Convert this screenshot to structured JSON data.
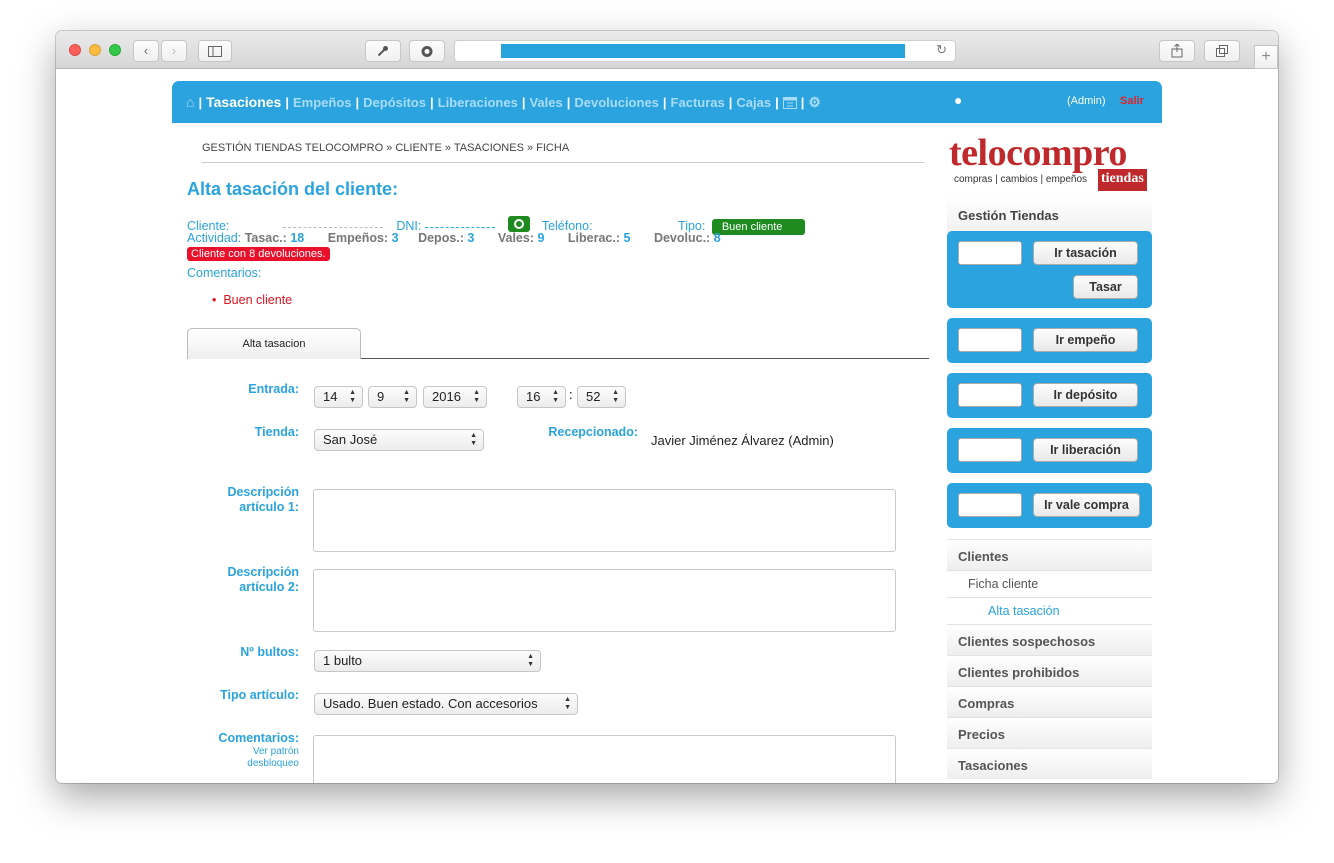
{
  "nav": {
    "items": [
      "Tasaciones",
      "Empeños",
      "Depósitos",
      "Liberaciones",
      "Vales",
      "Devoluciones",
      "Facturas",
      "Cajas"
    ],
    "user_label": "(Admin)",
    "logout": "Salir",
    "icons": [
      "home-icon",
      "calendar-icon",
      "gear-icon",
      "user-icon"
    ]
  },
  "breadcrumb": "GESTIÓN TIENDAS TELOCOMPRO » CLIENTE » TASACIONES » FICHA",
  "title": "Alta tasación del cliente:",
  "client": {
    "cliente_label": "Cliente:",
    "dni_label": "DNI:",
    "telefono_label": "Teléfono:",
    "tipo_label": "Tipo:",
    "tipo_value": "Buen cliente",
    "actividad_label": "Actividad:",
    "stats": [
      {
        "label": "Tasac.:",
        "value": "18"
      },
      {
        "label": "Empeños:",
        "value": "3"
      },
      {
        "label": "Depos.:",
        "value": "3"
      },
      {
        "label": "Vales:",
        "value": "9"
      },
      {
        "label": "Liberac.:",
        "value": "5"
      },
      {
        "label": "Devoluc.:",
        "value": "8"
      }
    ],
    "alert": "Cliente con 8 devoluciones.",
    "comentarios_label": "Comentarios:",
    "comentarios": [
      "Buen cliente"
    ]
  },
  "tab": "Alta tasacion",
  "form": {
    "entrada_label": "Entrada:",
    "day": "14",
    "month": "9",
    "year": "2016",
    "hour": "16",
    "minute": "52",
    "time_sep": ":",
    "tienda_label": "Tienda:",
    "tienda": "San José",
    "recepcionado_label": "Recepcionado:",
    "recepcionado": "Javier Jiménez Álvarez (Admin)",
    "desc1_label_a": "Descripción",
    "desc1_label_b": "artículo 1:",
    "desc2_label_a": "Descripción",
    "desc2_label_b": "artículo 2:",
    "bultos_label": "Nº bultos:",
    "bultos": "1 bulto",
    "tipo_articulo_label": "Tipo artículo:",
    "tipo_articulo": "Usado. Buen estado. Con accesorios",
    "comentarios_label": "Comentarios:",
    "patron_a": "Ver patrón",
    "patron_b": "desbloqueo"
  },
  "sidebar": {
    "logo_text": "telocompro",
    "logo_tagline": "compras | cambios | empeños",
    "logo_badge": "tiendas",
    "header": "Gestión Tiendas",
    "ir_tasacion": "Ir tasación",
    "tasar": "Tasar",
    "ir_empeno": "Ir empeño",
    "ir_deposito": "Ir depósito",
    "ir_liberacion": "Ir liberación",
    "ir_vale": "Ir vale compra",
    "menu": {
      "clientes": "Clientes",
      "ficha_cliente": "Ficha cliente",
      "alta_tasacion": "Alta tasación",
      "sospechosos": "Clientes sospechosos",
      "prohibidos": "Clientes prohibidos",
      "compras": "Compras",
      "precios": "Precios",
      "tasaciones": "Tasaciones"
    }
  },
  "colors": {
    "accent": "#2aa3de",
    "alert": "#e8102a",
    "good": "#1f8a1f",
    "brand": "#c0292b"
  }
}
